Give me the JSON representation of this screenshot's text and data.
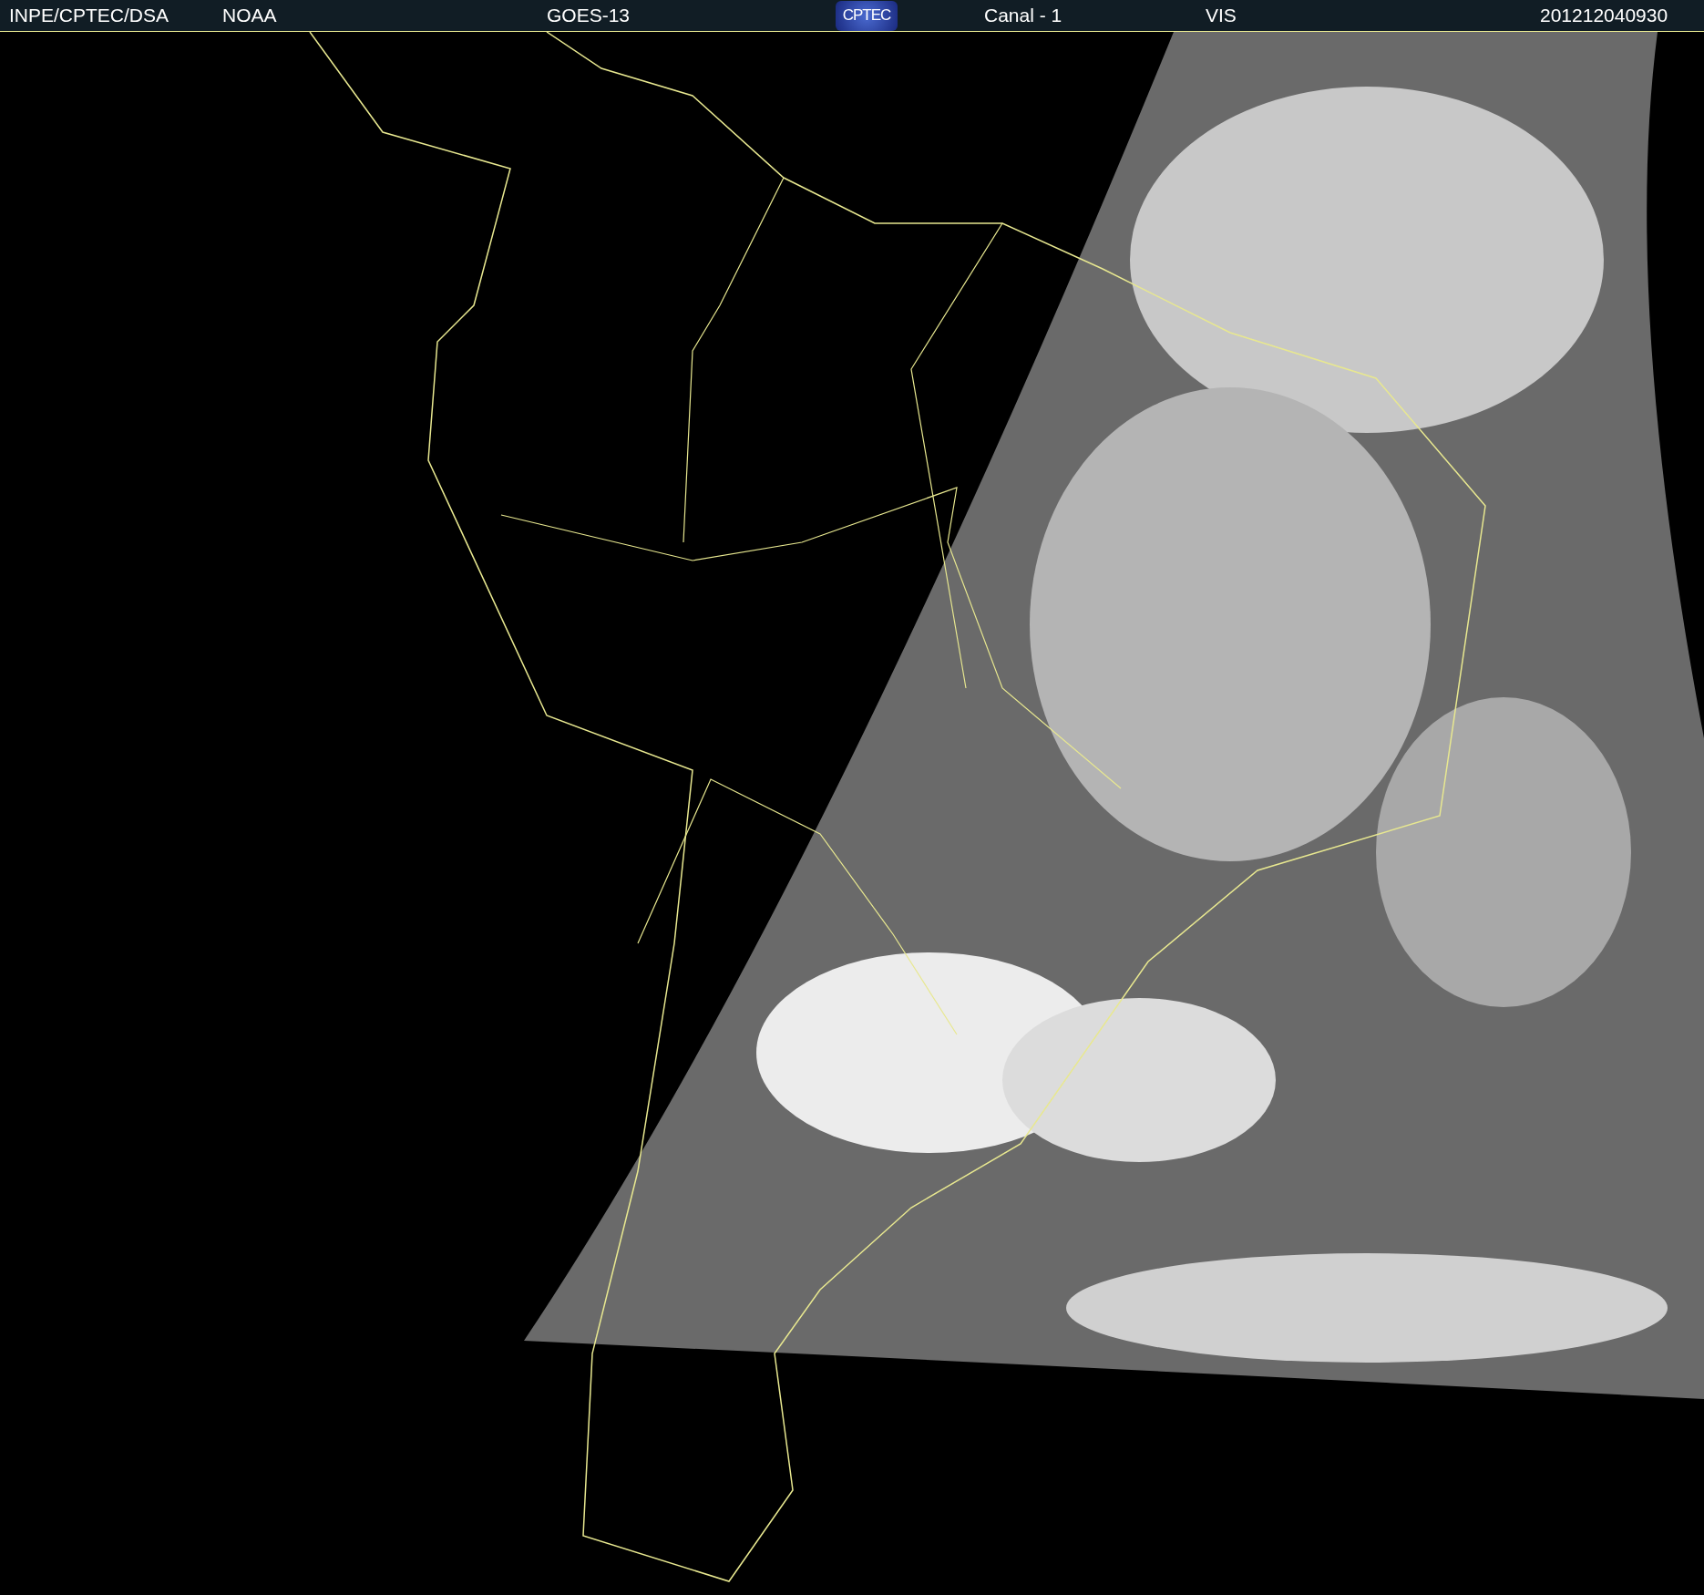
{
  "header": {
    "source": "INPE/CPTEC/DSA",
    "agency": "NOAA",
    "satellite": "GOES-13",
    "logo": "CPTEC",
    "channel": "Canal - 1",
    "band": "VIS",
    "timestamp": "201212040930"
  }
}
